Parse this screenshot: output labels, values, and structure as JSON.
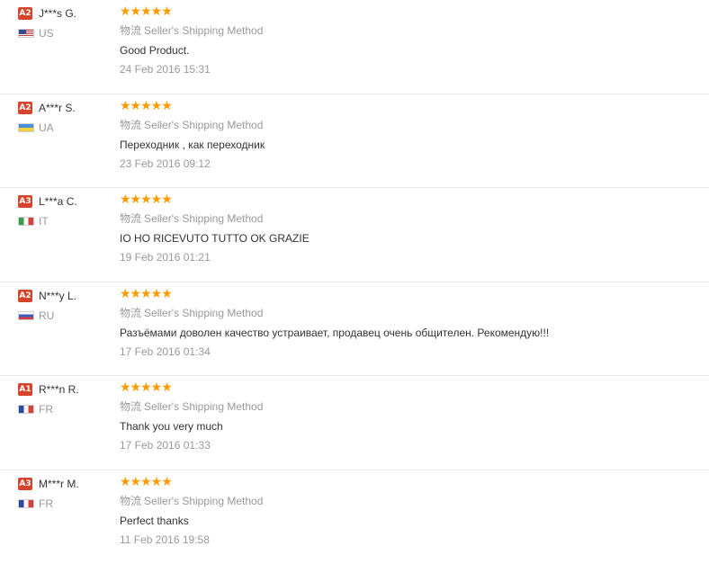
{
  "reviews": [
    {
      "level": "A2",
      "name": "J***s G.",
      "flag": "flag-us-icon",
      "country": "US",
      "rating": 5,
      "stars": "★★★★★",
      "logistics_label": "物流",
      "logistics_method": "Seller's Shipping Method",
      "feedback": "Good Product.",
      "date": "24 Feb 2016 15:31"
    },
    {
      "level": "A2",
      "name": "A***r S.",
      "flag": "flag-ua-icon",
      "country": "UA",
      "rating": 5,
      "stars": "★★★★★",
      "logistics_label": "物流",
      "logistics_method": "Seller's Shipping Method",
      "feedback": "Переходник , как переходник",
      "date": "23 Feb 2016 09:12"
    },
    {
      "level": "A3",
      "name": "L***a C.",
      "flag": "flag-it-icon",
      "country": "IT",
      "rating": 5,
      "stars": "★★★★★",
      "logistics_label": "物流",
      "logistics_method": "Seller's Shipping Method",
      "feedback": "IO HO RICEVUTO TUTTO OK GRAZIE",
      "date": "19 Feb 2016 01:21"
    },
    {
      "level": "A2",
      "name": "N***y L.",
      "flag": "flag-ru-icon",
      "country": "RU",
      "rating": 5,
      "stars": "★★★★★",
      "logistics_label": "物流",
      "logistics_method": "Seller's Shipping Method",
      "feedback": "Разъёмами доволен качество устраивает, продавец очень общителен. Рекомендую!!!",
      "date": "17 Feb 2016 01:34"
    },
    {
      "level": "A1",
      "name": "R***n R.",
      "flag": "flag-fr-icon",
      "country": "FR",
      "rating": 5,
      "stars": "★★★★★",
      "logistics_label": "物流",
      "logistics_method": "Seller's Shipping Method",
      "feedback": "Thank you very much",
      "date": "17 Feb 2016 01:33"
    },
    {
      "level": "A3",
      "name": "M***r M.",
      "flag": "flag-fr-icon",
      "country": "FR",
      "rating": 5,
      "stars": "★★★★★",
      "logistics_label": "物流",
      "logistics_method": "Seller's Shipping Method",
      "feedback": "Perfect thanks",
      "date": "11 Feb 2016 19:58"
    }
  ],
  "colors": {
    "level_badge": "#d6442b",
    "star": "#ff9a00",
    "muted_text": "#999999",
    "body_text": "#333333",
    "divider": "#e8e8e8"
  }
}
